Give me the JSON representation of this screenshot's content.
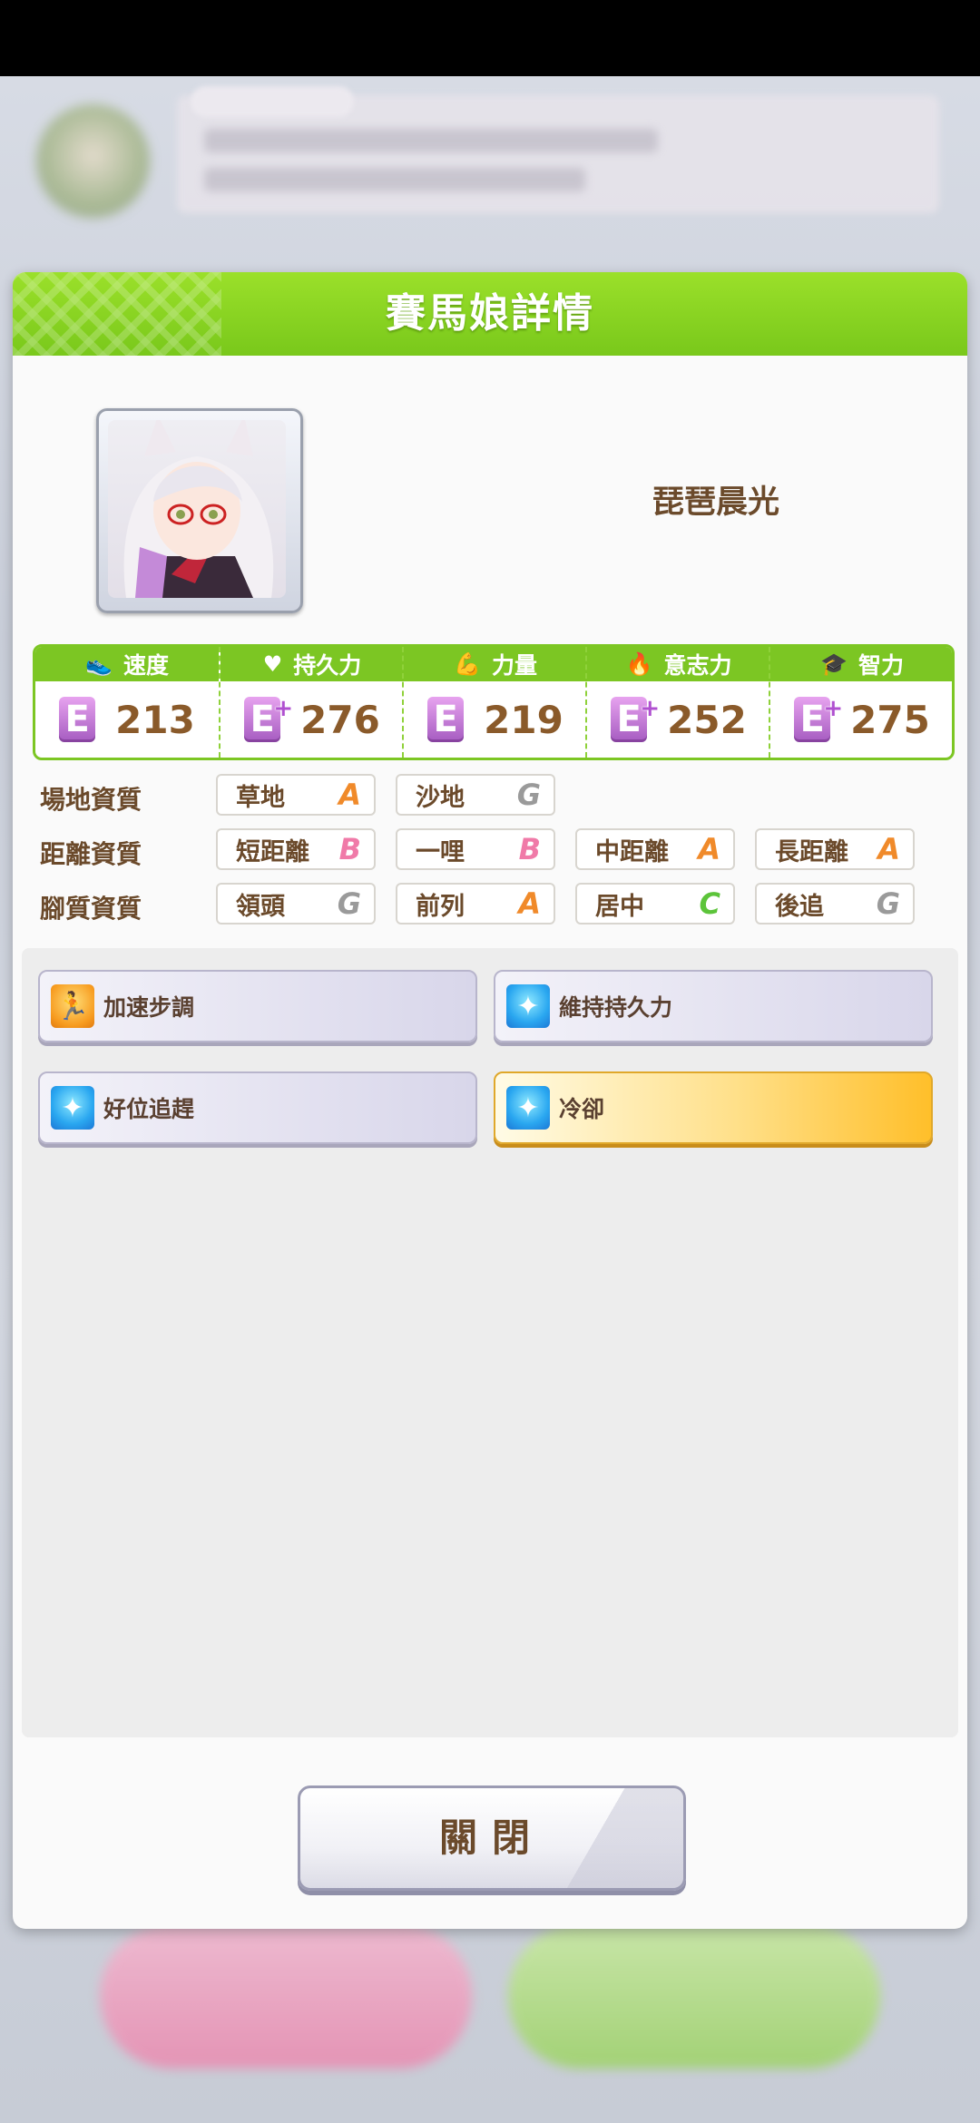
{
  "dialog": {
    "title": "賽馬娘詳情",
    "character_name": "琵琶晨光"
  },
  "stats": [
    {
      "label": "速度",
      "icon": "shoe-icon",
      "grade": "E",
      "plus": false,
      "value": "213"
    },
    {
      "label": "持久力",
      "icon": "heart-icon",
      "grade": "E",
      "plus": true,
      "value": "276"
    },
    {
      "label": "力量",
      "icon": "muscle-icon",
      "grade": "E",
      "plus": false,
      "value": "219"
    },
    {
      "label": "意志力",
      "icon": "flame-icon",
      "grade": "E",
      "plus": true,
      "value": "252"
    },
    {
      "label": "智力",
      "icon": "graduation-cap-icon",
      "grade": "E",
      "plus": true,
      "value": "275"
    }
  ],
  "aptitudes": {
    "track": {
      "label": "場地資質",
      "items": [
        {
          "name": "草地",
          "rank": "A"
        },
        {
          "name": "沙地",
          "rank": "G"
        }
      ]
    },
    "distance": {
      "label": "距離資質",
      "items": [
        {
          "name": "短距離",
          "rank": "B"
        },
        {
          "name": "一哩",
          "rank": "B"
        },
        {
          "name": "中距離",
          "rank": "A"
        },
        {
          "name": "長距離",
          "rank": "A"
        }
      ]
    },
    "style": {
      "label": "腳質資質",
      "items": [
        {
          "name": "領頭",
          "rank": "G"
        },
        {
          "name": "前列",
          "rank": "A"
        },
        {
          "name": "居中",
          "rank": "C"
        },
        {
          "name": "後追",
          "rank": "G"
        }
      ]
    }
  },
  "skills": [
    {
      "name": "加速步調",
      "icon": "running-figure-icon",
      "rarity": "normal"
    },
    {
      "name": "維持持久力",
      "icon": "sparkle-icon",
      "rarity": "normal"
    },
    {
      "name": "好位追趕",
      "icon": "sparkle-icon",
      "rarity": "normal"
    },
    {
      "name": "冷卻",
      "icon": "sparkle-icon",
      "rarity": "gold"
    }
  ],
  "close_button": {
    "label": "關閉"
  },
  "colors": {
    "header_green": "#79c81b",
    "grade_purple": "#a55bc0",
    "text_brown": "#6b4a2b",
    "gold": "#ffbf2a"
  }
}
